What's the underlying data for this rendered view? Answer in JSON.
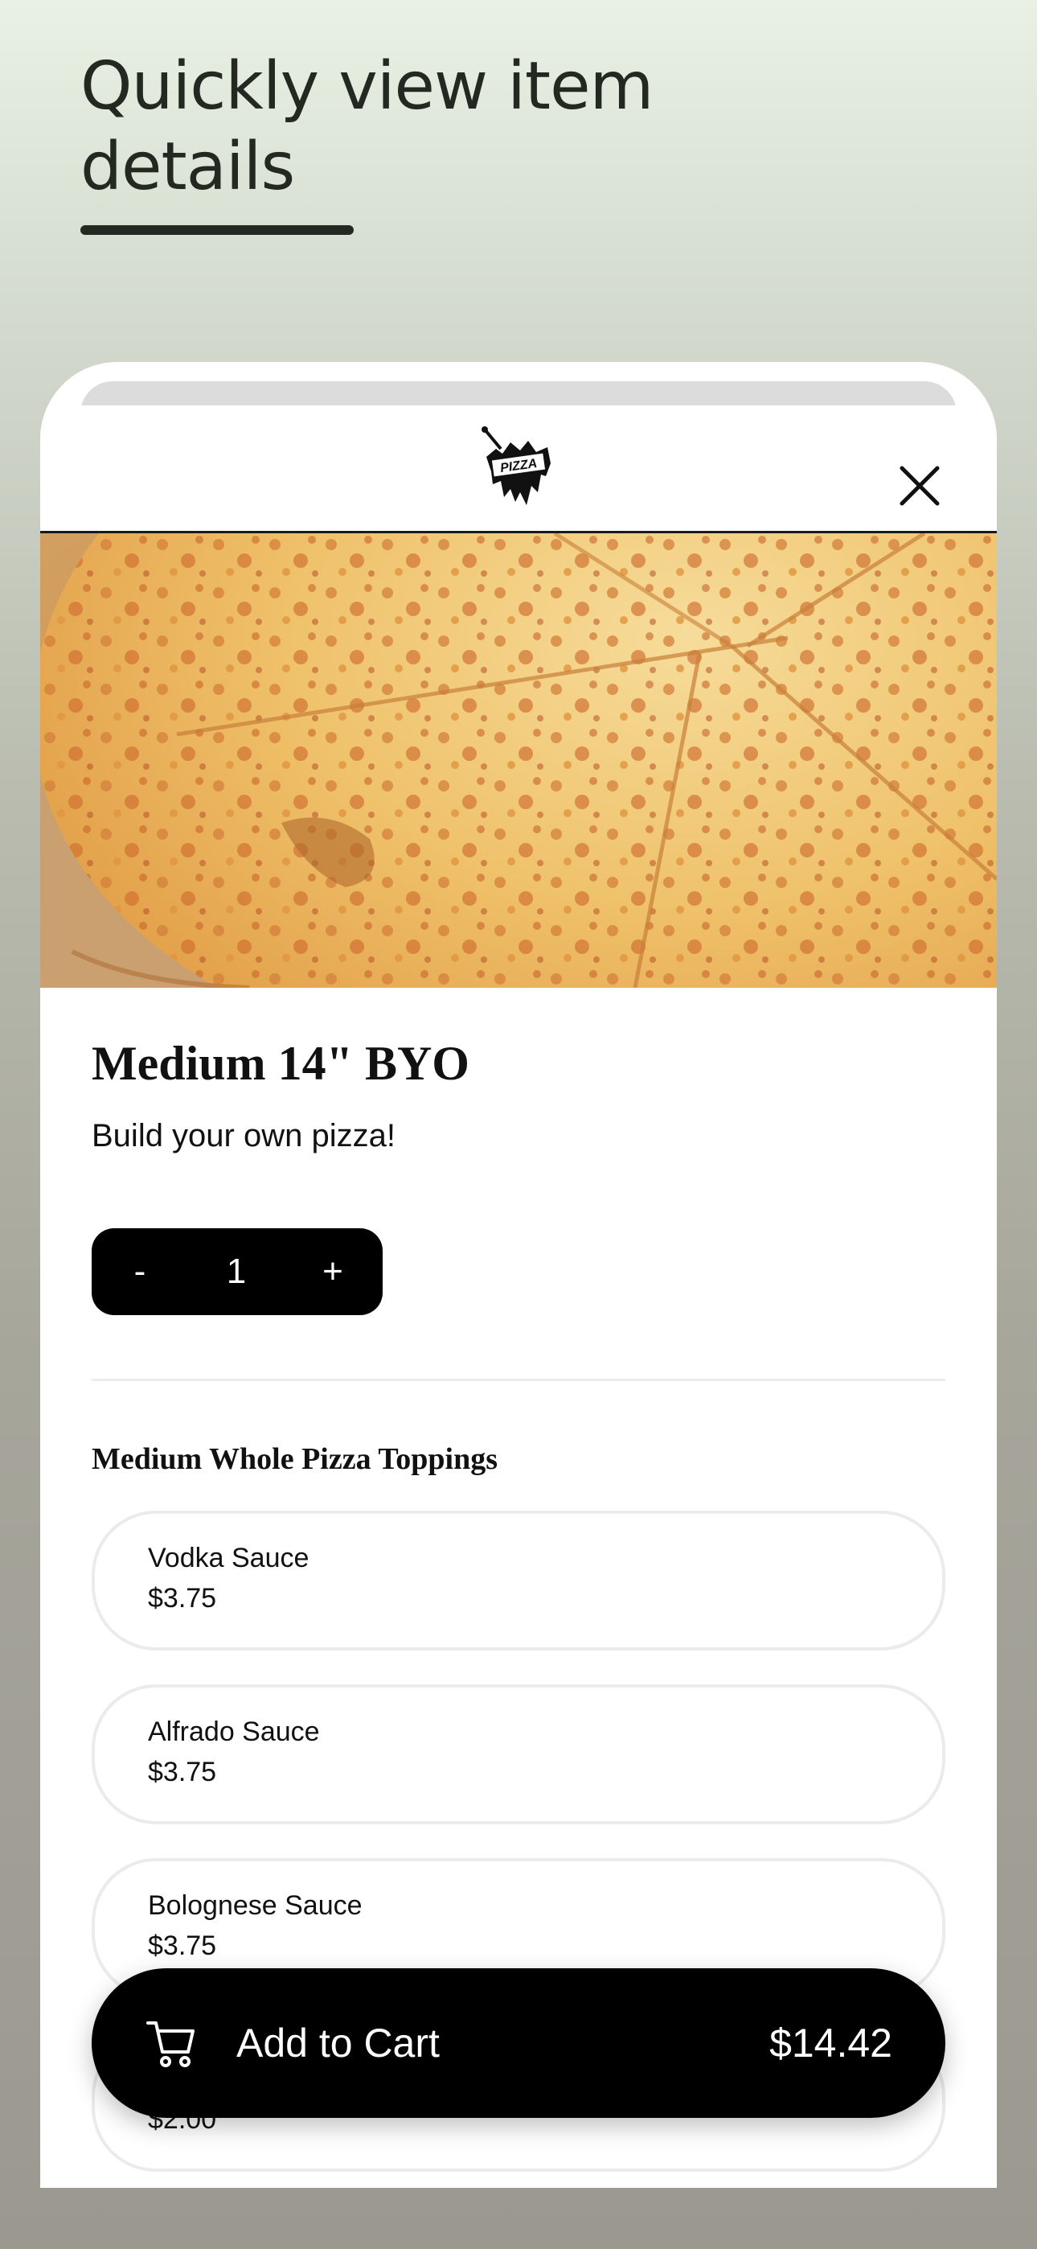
{
  "promo": {
    "headline_line1": "Quickly view item",
    "headline_line2": "details"
  },
  "header": {
    "logo_icon": "pizza-shop-logo",
    "close_icon": "close-icon"
  },
  "item": {
    "image_desc": "cheese-pizza-photo",
    "name": "Medium 14\" BYO",
    "description": "Build your own pizza!"
  },
  "quantity": {
    "decrement_label": "-",
    "value": "1",
    "increment_label": "+"
  },
  "toppings": {
    "section_title": "Medium Whole Pizza Toppings",
    "options": [
      {
        "name": "Vodka Sauce",
        "price": "$3.75"
      },
      {
        "name": "Alfrado Sauce",
        "price": "$3.75"
      },
      {
        "name": "Bolognese Sauce",
        "price": "$3.75"
      },
      {
        "name": "",
        "price": "$2.00"
      }
    ]
  },
  "cart": {
    "icon": "cart-icon",
    "label": "Add to Cart",
    "total": "$14.42"
  },
  "colors": {
    "accent": "#000000",
    "text": "#111111",
    "border": "#ebebeb"
  }
}
